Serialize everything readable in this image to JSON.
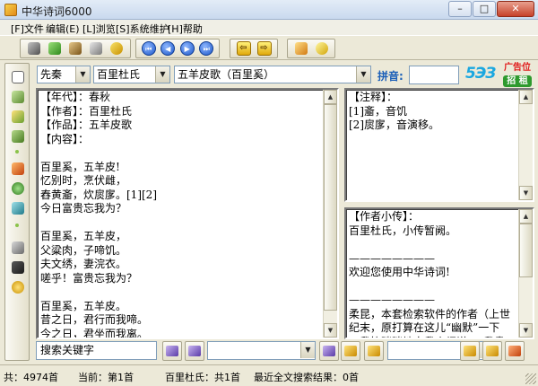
{
  "window": {
    "title": "中华诗词6000",
    "minimize": "–",
    "maximize": "□",
    "close": "✕"
  },
  "menu": [
    {
      "label": "[F]文件"
    },
    {
      "label": "编辑(E)"
    },
    {
      "label": "[L]浏览"
    },
    {
      "label": "[S]系统维护"
    },
    {
      "label": "[H]帮助"
    }
  ],
  "toolbar": {
    "nav": {
      "first": "⏮",
      "prev": "◀",
      "next": "▶",
      "last": "⏭"
    },
    "back": "⇦",
    "forward": "⇨",
    "icons": [
      "cut-icon",
      "copy-icon",
      "paste-icon",
      "print-icon",
      "undo-icon",
      "redo-icon",
      "book-icon",
      "refresh-icon"
    ]
  },
  "selectors": {
    "dynasty": "先秦",
    "author": "百里杜氏",
    "poem": "五羊皮歌（百里奚）"
  },
  "pinyin": {
    "label": "拼音:",
    "value": ""
  },
  "logo": {
    "ad_line": "广告位",
    "ad_sub": "招 租"
  },
  "main_text": "【年代】：春秋\n【作者】：百里杜氏\n【作品】：五羊皮歌\n【内容】：\n\n百里奚，五羊皮!\n忆别时，烹伏雌，\n舂黄齑，炊扊扅。[1][2]\n今日富贵忘我为？\n\n百里奚，五羊皮，\n父粱肉，子啼饥。\n夫文绣，妻浣衣。\n嗟乎！富贵忘我为？\n\n百里奚，五羊皮。\n昔之日，君行而我啼。\n今之日，君坐而我离。\n嗟乎！富贵忘我为？",
  "notes_text": "【注释】：\n[1]齑，音饥\n[2]扊扅，音演移。",
  "bio_text": "【作者小传】：\n百里杜氏，小传暂阙。\n\n————————\n欢迎您使用中华诗词!\n\n————————\n柔昆，本套检索软件的作者（上世\n纪末，原打算在这儿“幽默”一下\n，我笑眯眯地自我介绍说，“我贵\n姓方”，结果《中华诗词》的用户",
  "search": {
    "placeholder": "搜索关键字"
  },
  "status": {
    "total": "共：4974首",
    "current": "当前：第1首",
    "author_count": "百里杜氏：共1首",
    "search_result": "最近全文搜索结果：0首"
  },
  "colors": {
    "nav_blue": "#1c56c9",
    "accent_yellow": "#e0a90a",
    "pinyin_blue": "#1b5fb8",
    "ad_red": "#e01a1a",
    "ad_green": "#2e9a2e",
    "logo_cyan": "#1aa7e0"
  }
}
